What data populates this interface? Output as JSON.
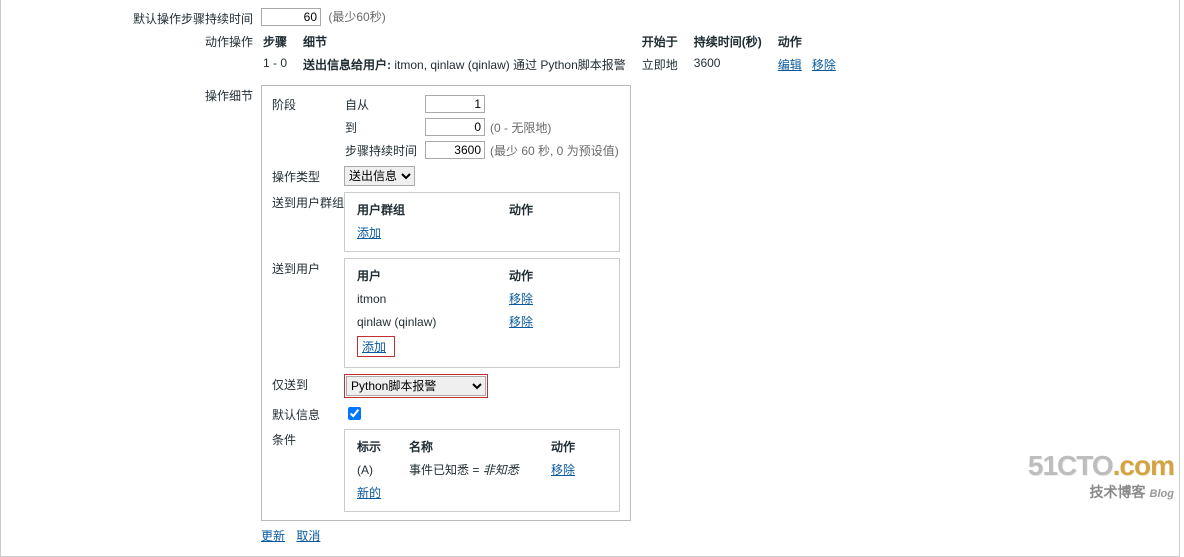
{
  "defaultDuration": {
    "label": "默认操作步骤持续时间",
    "value": "60",
    "hint": "(最少60秒)"
  },
  "actionOps": {
    "label": "动作操作",
    "headers": {
      "step": "步骤",
      "detail": "细节",
      "start": "开始于",
      "duration": "持续时间(秒)",
      "action": "动作"
    },
    "row": {
      "step": "1 - 0",
      "detailPrefix": "送出信息给用户:",
      "detailBody": " itmon, qinlaw (qinlaw) 通过 Python脚本报警",
      "start": "立即地",
      "duration": "3600",
      "edit": "编辑",
      "remove": "移除"
    }
  },
  "opDetail": {
    "label": "操作细节",
    "stage": {
      "label": "阶段",
      "fromLabel": "自从",
      "fromVal": "1",
      "toLabel": "到",
      "toVal": "0",
      "toHint": "(0 - 无限地)",
      "durLabel": "步骤持续时间",
      "durVal": "3600",
      "durHint": "(最少 60 秒, 0 为预设值)"
    },
    "opType": {
      "label": "操作类型",
      "value": "送出信息"
    },
    "sendGroups": {
      "label": "送到用户群组",
      "colGroup": "用户群组",
      "colAction": "动作",
      "add": "添加"
    },
    "sendUsers": {
      "label": "送到用户",
      "colUser": "用户",
      "colAction": "动作",
      "rows": [
        {
          "name": "itmon",
          "action": "移除"
        },
        {
          "name": "qinlaw (qinlaw)",
          "action": "移除"
        }
      ],
      "add": "添加"
    },
    "onlySend": {
      "label": "仅送到",
      "value": "Python脚本报警"
    },
    "defaultMsg": {
      "label": "默认信息",
      "checked": true
    },
    "conditions": {
      "label": "条件",
      "colTag": "标示",
      "colName": "名称",
      "colAction": "动作",
      "row": {
        "tag": "(A)",
        "namePrefix": "事件已知悉 = ",
        "nameItalic": "非知悉",
        "action": "移除"
      },
      "new": "新的"
    }
  },
  "footer": {
    "update": "更新",
    "cancel": "取消"
  },
  "watermark": {
    "line1a": "51CTO",
    "line1b": ".com",
    "line2": "技术博客",
    "line2b": "Blog"
  }
}
